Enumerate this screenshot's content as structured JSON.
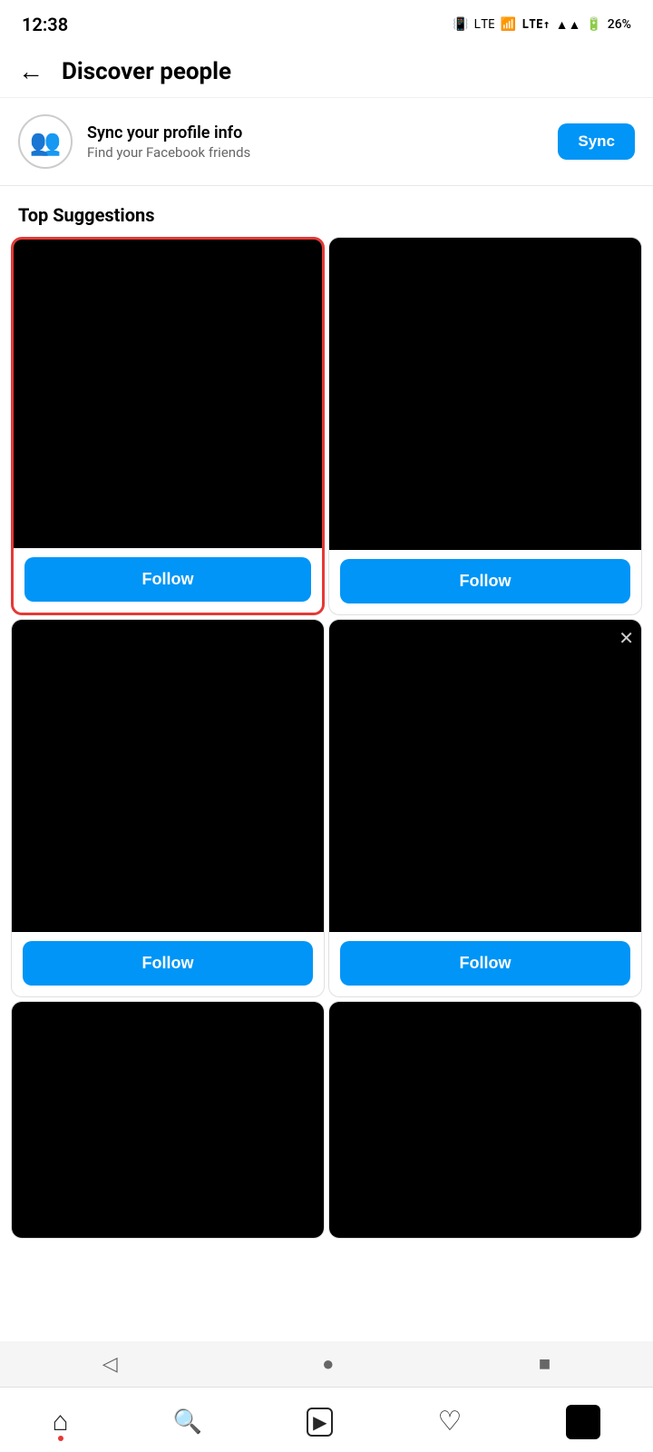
{
  "statusBar": {
    "time": "12:38",
    "battery": "26%",
    "signal": "LTE"
  },
  "header": {
    "backLabel": "←",
    "title": "Discover people"
  },
  "syncBanner": {
    "iconLabel": "👥",
    "title": "Sync your profile info",
    "subtitle": "Find your Facebook friends",
    "buttonLabel": "Sync"
  },
  "sectionTitle": "Top Suggestions",
  "cards": [
    {
      "id": 1,
      "highlighted": true,
      "followLabel": "Follow",
      "hasClose": false
    },
    {
      "id": 2,
      "highlighted": false,
      "followLabel": "Follow",
      "hasClose": false
    },
    {
      "id": 3,
      "highlighted": false,
      "followLabel": "Follow",
      "hasClose": false
    },
    {
      "id": 4,
      "highlighted": false,
      "followLabel": "Follow",
      "hasClose": true
    },
    {
      "id": 5,
      "highlighted": false,
      "followLabel": null,
      "hasClose": false
    },
    {
      "id": 6,
      "highlighted": false,
      "followLabel": null,
      "hasClose": false
    }
  ],
  "bottomNav": {
    "items": [
      {
        "name": "home",
        "icon": "⌂",
        "hasDot": true
      },
      {
        "name": "search",
        "icon": "🔍",
        "hasDot": false
      },
      {
        "name": "reels",
        "icon": "▶",
        "hasDot": false
      },
      {
        "name": "heart",
        "icon": "♡",
        "hasDot": false
      }
    ],
    "profileLabel": "profile"
  },
  "systemNav": {
    "back": "◁",
    "home": "●",
    "recents": "■"
  }
}
